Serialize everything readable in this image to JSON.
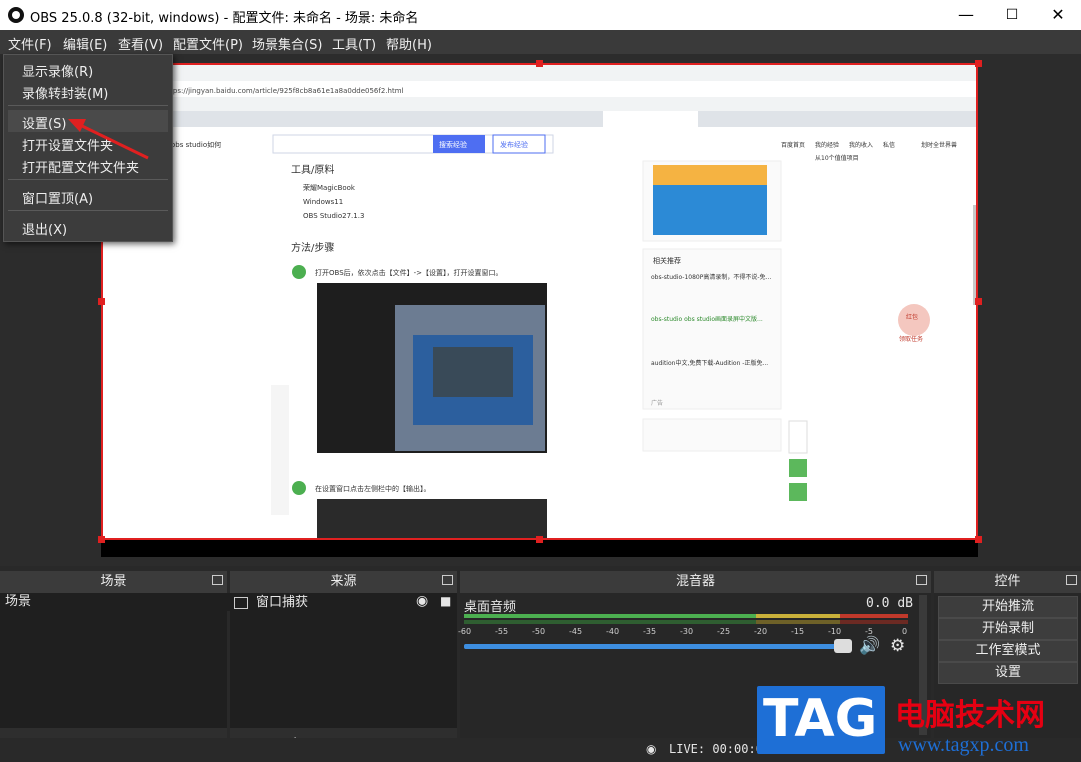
{
  "window": {
    "title": "OBS 25.0.8 (32-bit, windows) - 配置文件: 未命名 - 场景: 未命名",
    "minimize_icon": "minimize-icon",
    "maximize_icon": "maximize-icon",
    "close_icon": "close-icon"
  },
  "menu": [
    "文件(F)",
    "编辑(E)",
    "查看(V)",
    "配置文件(P)",
    "场景集合(S)",
    "工具(T)",
    "帮助(H)"
  ],
  "file_menu": {
    "show_recordings": "显示录像(R)",
    "remux": "录像转封装(M)",
    "settings": "设置(S)",
    "open_settings_folder": "打开设置文件夹",
    "open_profile_folder": "打开配置文件文件夹",
    "always_on_top": "窗口置顶(A)",
    "exit": "退出(X)"
  },
  "preview": {
    "url": "https://jingyan.baidu.com/article/925f8cb8a61e1a8a0dde056f2.html",
    "search_text": "obs studio如何",
    "search_button": "搜索经验",
    "publish_button": "发布经验",
    "nav": [
      "百度首页",
      "我的经验",
      "我的收入",
      "私信",
      "划时全世界兽"
    ],
    "section_tools": "工具/原料",
    "tools": [
      "荣耀MagicBook",
      "Windows11",
      "OBS Studio27.1.3"
    ],
    "section_steps": "方法/步骤",
    "step1": "打开OBS后，依次点击【文件】->【设置】，打开设置窗口。",
    "step2": "在设置窗口点击左侧栏中的【输出】。",
    "related": "相关推荐",
    "related_items": [
      "obs-studio-1080P高清录制，不得不说-免...",
      "obs-studio obs studio画面录屏中文版...",
      "audition中文,免费下载-Audition -正版免..."
    ],
    "ad_label": "广告",
    "side_badge": "红包",
    "side_task": "领取任务",
    "promo_count": "从10个值值项目"
  },
  "docks": {
    "scenes": {
      "title": "场景",
      "items": [
        "场景"
      ]
    },
    "sources": {
      "title": "来源",
      "items": [
        "窗口捕获"
      ]
    },
    "mixer": {
      "title": "混音器",
      "channel": "桌面音频",
      "level": "0.0 dB",
      "ticks": [
        "-60",
        "-55",
        "-50",
        "-45",
        "-40",
        "-35",
        "-30",
        "-25",
        "-20",
        "-15",
        "-10",
        "-5",
        "0"
      ],
      "volume": 1.0
    },
    "controls": {
      "title": "控件",
      "buttons": [
        "开始推流",
        "开始录制",
        "工作室模式",
        "设置"
      ]
    }
  },
  "status": {
    "live": "LIVE: 00:00:00"
  },
  "watermark": {
    "tag": "TAG",
    "cn": "电脑技术网",
    "url": "www.tagxp.com"
  },
  "colors": {
    "accent": "#e02020",
    "tag_blue": "#1e6fd6",
    "wm_red": "#e60012",
    "meter_green": "#4caf50",
    "meter_yellow": "#c9b13a",
    "meter_red": "#c0392b"
  }
}
